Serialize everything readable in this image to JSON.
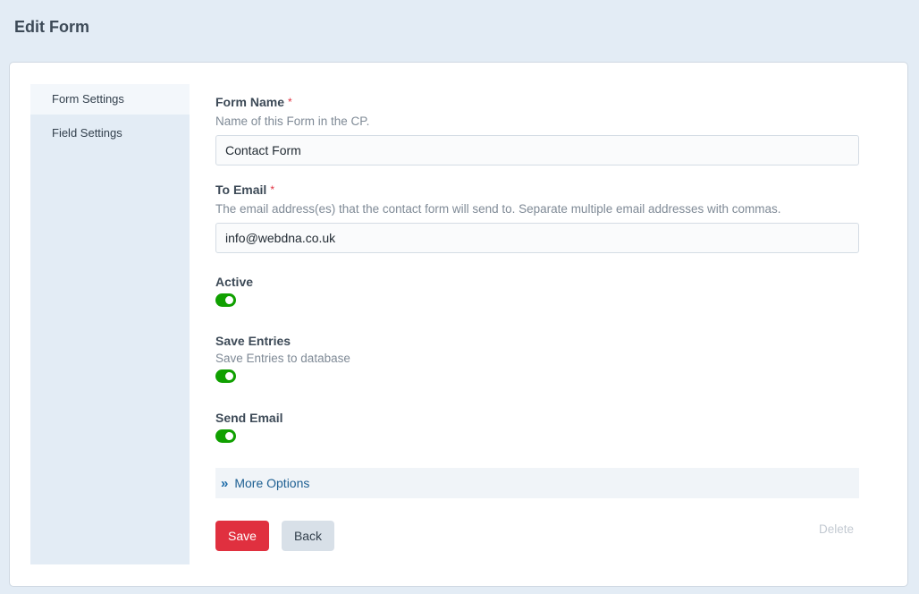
{
  "page": {
    "title": "Edit Form"
  },
  "sidebar": {
    "items": [
      {
        "label": "Form Settings",
        "active": true
      },
      {
        "label": "Field Settings",
        "active": false
      }
    ]
  },
  "form": {
    "form_name": {
      "label": "Form Name",
      "required_marker": "*",
      "help": "Name of this Form in the CP.",
      "value": "Contact Form"
    },
    "to_email": {
      "label": "To Email",
      "required_marker": "*",
      "help": "The email address(es) that the contact form will send to. Separate multiple email addresses with commas.",
      "value": "info@webdna.co.uk"
    },
    "active": {
      "label": "Active",
      "on": true
    },
    "save_entries": {
      "label": "Save Entries",
      "help": "Save Entries to database",
      "on": true
    },
    "send_email": {
      "label": "Send Email",
      "on": true
    },
    "more_options": {
      "icon": "double-chevron-right-icon",
      "glyph": "»",
      "label": "More Options"
    }
  },
  "actions": {
    "save_label": "Save",
    "back_label": "Back",
    "delete_label": "Delete"
  },
  "colors": {
    "toggle_on": "#10a000",
    "save_button": "#e0303f",
    "link": "#1d5f92",
    "background": "#e3ecf5"
  }
}
